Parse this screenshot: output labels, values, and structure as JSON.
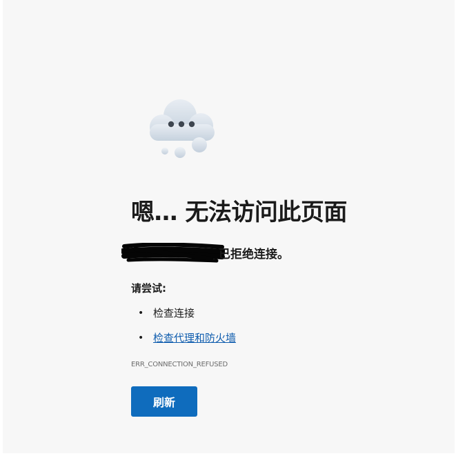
{
  "error_page": {
    "icon": "cloud-with-dots-icon",
    "title": "嗯… 无法访问此页面",
    "message_suffix": "已拒绝连接。",
    "try_heading": "请尝试:",
    "suggestions": [
      {
        "text": "检查连接",
        "is_link": false
      },
      {
        "text": "检查代理和防火墙",
        "is_link": true
      }
    ],
    "error_code": "ERR_CONNECTION_REFUSED",
    "refresh_label": "刷新"
  },
  "colors": {
    "page_background": "#f7f7f7",
    "accent_button": "#0f6cbd",
    "link": "#0e5cae",
    "text": "#1b1b1b",
    "muted_text": "#6b6b6b"
  }
}
